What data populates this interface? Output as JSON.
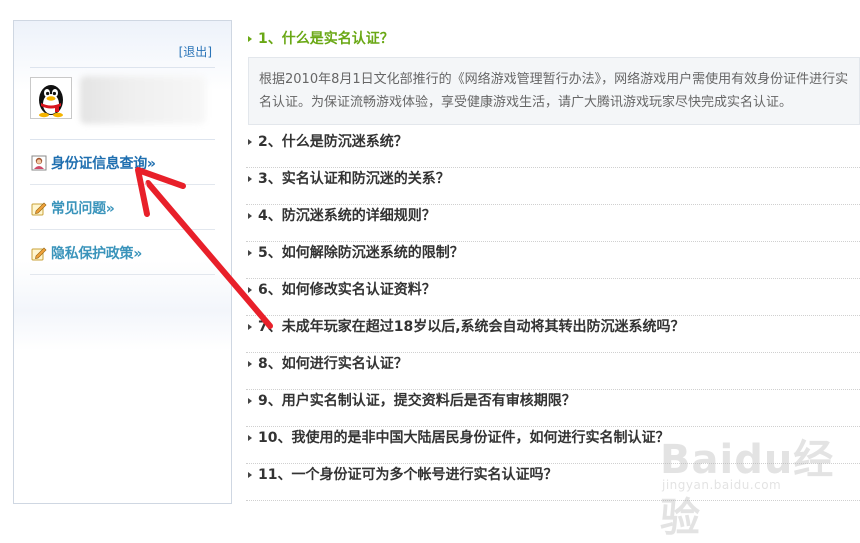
{
  "sidebar": {
    "logout_label": "退出",
    "nav": [
      {
        "label": "身份证信息查询»",
        "icon": "person-card-icon"
      },
      {
        "label": "常见问题»",
        "icon": "pencil-icon"
      },
      {
        "label": "隐私保护政策»",
        "icon": "pencil-icon"
      }
    ]
  },
  "faq": {
    "open_question": "1、什么是实名认证？",
    "answer": "根据2010年8月1日文化部推行的《网络游戏管理暂行办法》，网络游戏用户需使用有效身份证件进行实名认证。为保证流畅游戏体验，享受健康游戏生活，请广大腾讯游戏玩家尽快完成实名认证。",
    "questions": [
      "2、什么是防沉迷系统？",
      "3、实名认证和防沉迷的关系？",
      "4、防沉迷系统的详细规则？",
      "5、如何解除防沉迷系统的限制？",
      "6、如何修改实名认证资料？",
      "7、未成年玩家在超过18岁以后,系统会自动将其转出防沉迷系统吗？",
      "8、如何进行实名认证？",
      "9、用户实名制认证，提交资料后是否有审核期限？",
      "10、我使用的是非中国大陆居民身份证件，如何进行实名制认证？",
      "11、一个身份证可为多个帐号进行实名认证吗？"
    ]
  },
  "watermark": {
    "brand": "Baidu经验",
    "url": "jingyan.baidu.com"
  },
  "colors": {
    "accent_green": "#6aa815",
    "link_blue": "#1f6fb0",
    "arrow_red": "#e8202a"
  }
}
